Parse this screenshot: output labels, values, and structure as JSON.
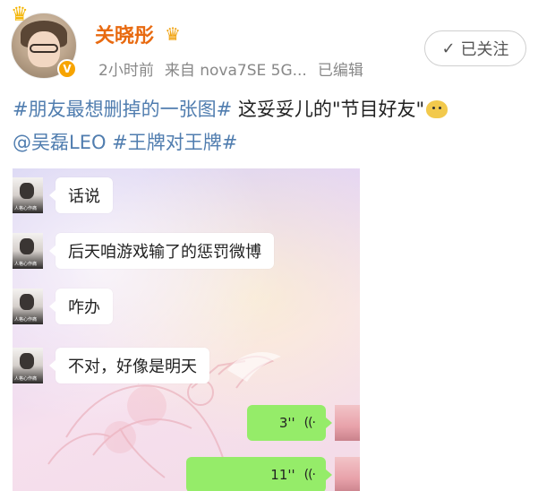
{
  "post": {
    "username": "关晓彤",
    "meta": {
      "time": "2小时前",
      "source": "来自 nova7SE 5G...",
      "edited": "已编辑"
    },
    "follow_label": "已关注",
    "text": {
      "hashtag1": "#朋友最想删掉的一张图#",
      "body": " 这妥妥儿的\"节目好友\"",
      "mention": "@吴磊LEO",
      "hashtag2": " #王牌对王牌#"
    }
  },
  "chat": {
    "messages": [
      {
        "text": "话说"
      },
      {
        "text": "后天咱游戏输了的惩罚微博"
      },
      {
        "text": "咋办"
      },
      {
        "text": "不对，好像是明天"
      }
    ],
    "voice_messages": [
      {
        "duration": "3''",
        "wave": "((·"
      },
      {
        "duration": "11''",
        "wave": "((·"
      }
    ]
  },
  "colors": {
    "username": "#e86a10",
    "link": "#507daf",
    "voice_bubble": "#95ec69"
  },
  "icons": {
    "follow": "check-icon",
    "vip": "crown-icon",
    "verified": "verified-badge-icon",
    "emoji": "doge-emoji-icon"
  }
}
